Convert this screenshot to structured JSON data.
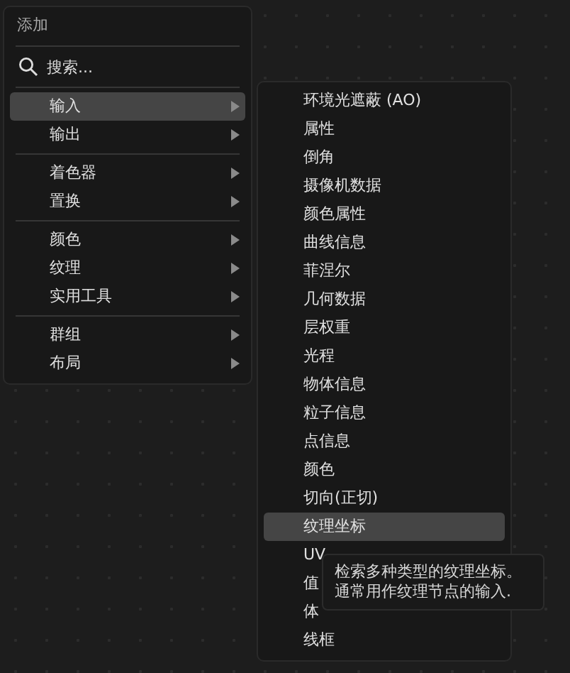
{
  "menu": {
    "title": "添加",
    "search": {
      "placeholder": "搜索..."
    },
    "groups": [
      [
        {
          "label": "输入",
          "selected": true,
          "submenu": true
        },
        {
          "label": "输出",
          "selected": false,
          "submenu": true
        }
      ],
      [
        {
          "label": "着色器",
          "selected": false,
          "submenu": true
        },
        {
          "label": "置换",
          "selected": false,
          "submenu": true
        }
      ],
      [
        {
          "label": "颜色",
          "selected": false,
          "submenu": true
        },
        {
          "label": "纹理",
          "selected": false,
          "submenu": true
        },
        {
          "label": "实用工具",
          "selected": false,
          "submenu": true
        }
      ],
      [
        {
          "label": "群组",
          "selected": false,
          "submenu": true
        },
        {
          "label": "布局",
          "selected": false,
          "submenu": true
        }
      ]
    ]
  },
  "submenu": {
    "items": [
      {
        "label": "环境光遮蔽 (AO)",
        "selected": false
      },
      {
        "label": "属性",
        "selected": false
      },
      {
        "label": "倒角",
        "selected": false
      },
      {
        "label": "摄像机数据",
        "selected": false
      },
      {
        "label": "颜色属性",
        "selected": false
      },
      {
        "label": "曲线信息",
        "selected": false
      },
      {
        "label": "菲涅尔",
        "selected": false
      },
      {
        "label": "几何数据",
        "selected": false
      },
      {
        "label": "层权重",
        "selected": false
      },
      {
        "label": "光程",
        "selected": false
      },
      {
        "label": "物体信息",
        "selected": false
      },
      {
        "label": "粒子信息",
        "selected": false
      },
      {
        "label": "点信息",
        "selected": false
      },
      {
        "label": "颜色",
        "selected": false
      },
      {
        "label": "切向(正切)",
        "selected": false
      },
      {
        "label": "纹理坐标",
        "selected": true
      },
      {
        "label": "UV",
        "selected": false
      },
      {
        "label": "值",
        "selected": false
      },
      {
        "label": "体",
        "selected": false
      },
      {
        "label": "线框",
        "selected": false
      }
    ]
  },
  "tooltip": {
    "lines": [
      "检索多种类型的纹理坐标。",
      "通常用作纹理节点的输入."
    ]
  }
}
